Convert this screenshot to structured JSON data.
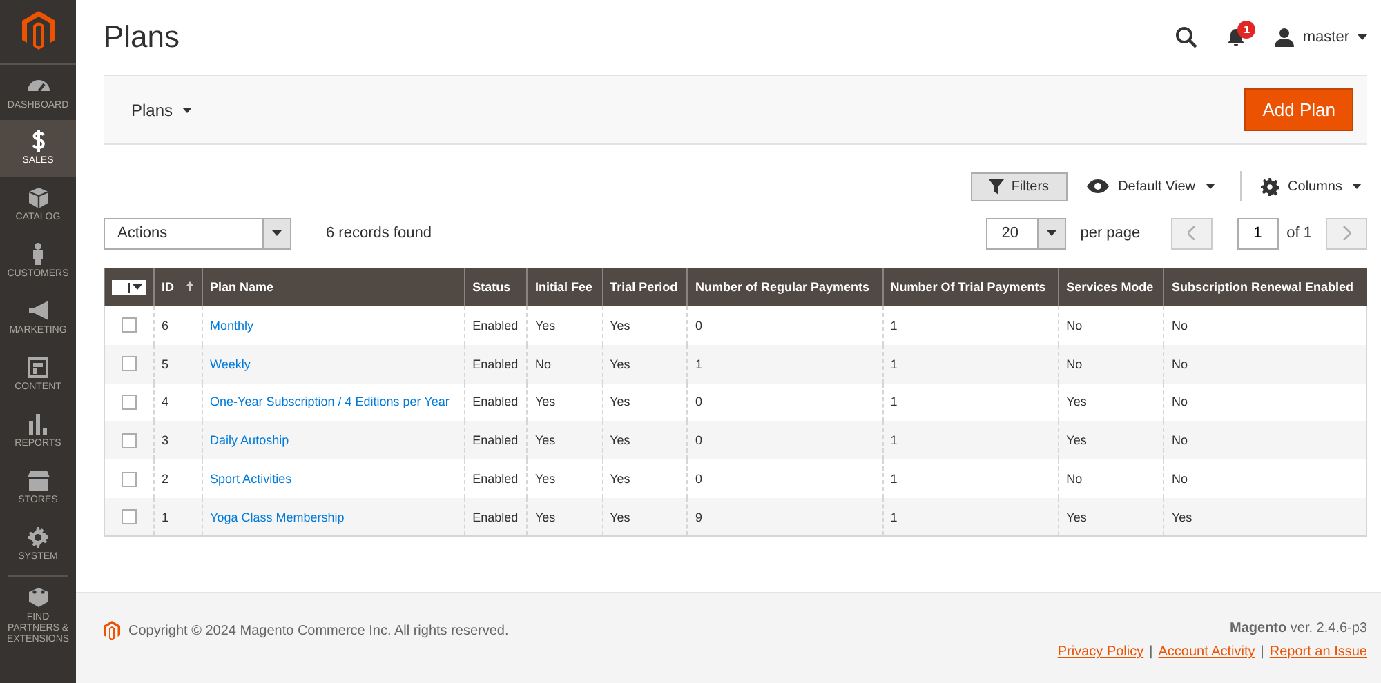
{
  "sidebar": {
    "items": [
      {
        "label": "DASHBOARD",
        "selected": false
      },
      {
        "label": "SALES",
        "selected": true
      },
      {
        "label": "CATALOG",
        "selected": false
      },
      {
        "label": "CUSTOMERS",
        "selected": false
      },
      {
        "label": "MARKETING",
        "selected": false
      },
      {
        "label": "CONTENT",
        "selected": false
      },
      {
        "label": "REPORTS",
        "selected": false
      },
      {
        "label": "STORES",
        "selected": false
      },
      {
        "label": "SYSTEM",
        "selected": false
      },
      {
        "label": "FIND PARTNERS & EXTENSIONS",
        "selected": false
      }
    ]
  },
  "header": {
    "title": "Plans",
    "notifications": "1",
    "user": "master"
  },
  "page_actions": {
    "switcher": "Plans",
    "add_button": "Add Plan"
  },
  "toolbar": {
    "filters": "Filters",
    "view": "Default View",
    "columns": "Columns"
  },
  "grid_controls": {
    "actions": "Actions",
    "records": "6 records found",
    "per_page_value": "20",
    "per_page_label": "per page",
    "page": "1",
    "page_total": "of 1"
  },
  "table": {
    "columns": [
      "ID",
      "Plan Name",
      "Status",
      "Initial Fee",
      "Trial Period",
      "Number of Regular Payments",
      "Number Of Trial Payments",
      "Services Mode",
      "Subscription Renewal Enabled"
    ],
    "rows": [
      {
        "checked": false,
        "cells": [
          "6",
          "Monthly",
          "Enabled",
          "Yes",
          "Yes",
          "0",
          "1",
          "No",
          "No"
        ]
      },
      {
        "checked": false,
        "cells": [
          "5",
          "Weekly",
          "Enabled",
          "No",
          "Yes",
          "1",
          "1",
          "No",
          "No"
        ]
      },
      {
        "checked": false,
        "cells": [
          "4",
          "One-Year Subscription / 4 Editions per Year",
          "Enabled",
          "Yes",
          "Yes",
          "0",
          "1",
          "Yes",
          "No"
        ]
      },
      {
        "checked": false,
        "cells": [
          "3",
          "Daily Autoship",
          "Enabled",
          "Yes",
          "Yes",
          "0",
          "1",
          "Yes",
          "No"
        ]
      },
      {
        "checked": false,
        "cells": [
          "2",
          "Sport Activities",
          "Enabled",
          "Yes",
          "Yes",
          "0",
          "1",
          "No",
          "No"
        ]
      },
      {
        "checked": false,
        "cells": [
          "1",
          "Yoga Class Membership",
          "Enabled",
          "Yes",
          "Yes",
          "9",
          "1",
          "Yes",
          "Yes"
        ]
      }
    ]
  },
  "footer": {
    "copyright": "Copyright © 2024 Magento Commerce Inc. All rights reserved.",
    "version": "**Magento** ver. 2.4.6-p3",
    "links": [
      {
        "kind": "link",
        "text": "Privacy Policy"
      },
      {
        "kind": "separator",
        "text": "|"
      },
      {
        "kind": "link",
        "text": "Account Activity"
      },
      {
        "kind": "separator",
        "text": "|"
      },
      {
        "kind": "link",
        "text": "Report an Issue"
      }
    ]
  }
}
